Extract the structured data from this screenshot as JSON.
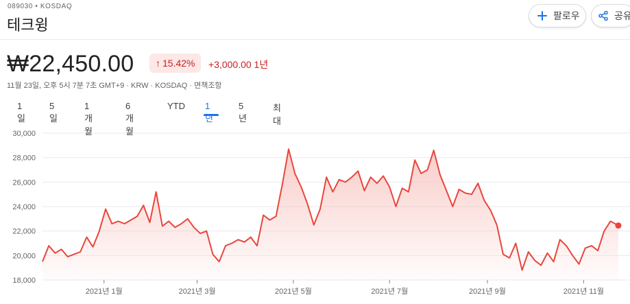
{
  "header": {
    "ticker": "089030 • KOSDAQ",
    "company_name": "테크윙",
    "follow_label": "팔로우",
    "share_label": "공유"
  },
  "quote": {
    "price": "₩22,450.00",
    "change_percent": "15.42%",
    "change_amount": "+3,000.00 1년",
    "meta": "11월 23일, 오후 5시 7분 7초 GMT+9 · KRW · KOSDAQ · 면책조항"
  },
  "ranges": {
    "items": [
      "1일",
      "5일",
      "1개월",
      "6개월",
      "YTD",
      "1년",
      "5년",
      "최대"
    ],
    "selected": "1년"
  },
  "colors": {
    "line": "#e8453c",
    "fill_top": "#f8c7c3",
    "negative_text": "#c5221f",
    "accent": "#1a73e8"
  },
  "icons": {
    "follow": "plus-icon",
    "share": "share-icon"
  },
  "chart_data": {
    "type": "area",
    "ylim": [
      18000,
      30000
    ],
    "y_ticks": [
      "18,000",
      "20,000",
      "22,000",
      "24,000",
      "26,000",
      "28,000",
      "30,000"
    ],
    "y_tick_values": [
      18000,
      20000,
      22000,
      24000,
      26000,
      28000,
      30000
    ],
    "x_ticks": [
      "2021년 1월",
      "2021년 3월",
      "2021년 5월",
      "2021년 7월",
      "2021년 9월",
      "2021년 11월"
    ],
    "x_tick_dates": [
      "2021-01-01",
      "2021-03-01",
      "2021-05-01",
      "2021-07-01",
      "2021-09-01",
      "2021-11-01"
    ],
    "x_range": [
      "2020-11-23",
      "2021-11-23"
    ],
    "grid": true,
    "series": [
      {
        "points": [
          [
            "2020-11-23",
            19500
          ],
          [
            "2020-11-27",
            20800
          ],
          [
            "2020-12-01",
            20200
          ],
          [
            "2020-12-05",
            20500
          ],
          [
            "2020-12-09",
            19900
          ],
          [
            "2020-12-13",
            20100
          ],
          [
            "2020-12-17",
            20300
          ],
          [
            "2020-12-21",
            21500
          ],
          [
            "2020-12-25",
            20700
          ],
          [
            "2020-12-29",
            22000
          ],
          [
            "2021-01-02",
            23800
          ],
          [
            "2021-01-06",
            22600
          ],
          [
            "2021-01-10",
            22800
          ],
          [
            "2021-01-14",
            22600
          ],
          [
            "2021-01-18",
            22900
          ],
          [
            "2021-01-22",
            23200
          ],
          [
            "2021-01-26",
            24100
          ],
          [
            "2021-01-30",
            22700
          ],
          [
            "2021-02-03",
            25200
          ],
          [
            "2021-02-07",
            22400
          ],
          [
            "2021-02-11",
            22800
          ],
          [
            "2021-02-15",
            22300
          ],
          [
            "2021-02-19",
            22600
          ],
          [
            "2021-02-23",
            23000
          ],
          [
            "2021-02-27",
            22300
          ],
          [
            "2021-03-03",
            21800
          ],
          [
            "2021-03-07",
            22000
          ],
          [
            "2021-03-11",
            20100
          ],
          [
            "2021-03-15",
            19500
          ],
          [
            "2021-03-19",
            20800
          ],
          [
            "2021-03-23",
            21000
          ],
          [
            "2021-03-27",
            21300
          ],
          [
            "2021-03-31",
            21100
          ],
          [
            "2021-04-04",
            21500
          ],
          [
            "2021-04-08",
            20800
          ],
          [
            "2021-04-12",
            23300
          ],
          [
            "2021-04-16",
            22900
          ],
          [
            "2021-04-20",
            23200
          ],
          [
            "2021-04-24",
            25800
          ],
          [
            "2021-04-28",
            28700
          ],
          [
            "2021-05-02",
            26700
          ],
          [
            "2021-05-06",
            25600
          ],
          [
            "2021-05-10",
            24200
          ],
          [
            "2021-05-14",
            22500
          ],
          [
            "2021-05-18",
            23800
          ],
          [
            "2021-05-22",
            26400
          ],
          [
            "2021-05-26",
            25200
          ],
          [
            "2021-05-30",
            26200
          ],
          [
            "2021-06-03",
            26000
          ],
          [
            "2021-06-07",
            26400
          ],
          [
            "2021-06-11",
            26900
          ],
          [
            "2021-06-15",
            25300
          ],
          [
            "2021-06-19",
            26400
          ],
          [
            "2021-06-23",
            25900
          ],
          [
            "2021-06-27",
            26500
          ],
          [
            "2021-07-01",
            25600
          ],
          [
            "2021-07-05",
            24000
          ],
          [
            "2021-07-09",
            25500
          ],
          [
            "2021-07-13",
            25200
          ],
          [
            "2021-07-17",
            27800
          ],
          [
            "2021-07-21",
            26700
          ],
          [
            "2021-07-25",
            27000
          ],
          [
            "2021-07-29",
            28600
          ],
          [
            "2021-08-02",
            26600
          ],
          [
            "2021-08-06",
            25300
          ],
          [
            "2021-08-10",
            24000
          ],
          [
            "2021-08-14",
            25400
          ],
          [
            "2021-08-18",
            25100
          ],
          [
            "2021-08-22",
            25000
          ],
          [
            "2021-08-26",
            25900
          ],
          [
            "2021-08-30",
            24500
          ],
          [
            "2021-09-03",
            23700
          ],
          [
            "2021-09-07",
            22500
          ],
          [
            "2021-09-11",
            20100
          ],
          [
            "2021-09-15",
            19800
          ],
          [
            "2021-09-19",
            21000
          ],
          [
            "2021-09-23",
            18800
          ],
          [
            "2021-09-27",
            20300
          ],
          [
            "2021-10-01",
            19600
          ],
          [
            "2021-10-05",
            19200
          ],
          [
            "2021-10-09",
            20200
          ],
          [
            "2021-10-13",
            19500
          ],
          [
            "2021-10-17",
            21300
          ],
          [
            "2021-10-21",
            20800
          ],
          [
            "2021-10-25",
            20000
          ],
          [
            "2021-10-29",
            19300
          ],
          [
            "2021-11-02",
            20600
          ],
          [
            "2021-11-06",
            20800
          ],
          [
            "2021-11-10",
            20400
          ],
          [
            "2021-11-14",
            22000
          ],
          [
            "2021-11-18",
            22800
          ],
          [
            "2021-11-23",
            22450
          ]
        ]
      }
    ]
  }
}
